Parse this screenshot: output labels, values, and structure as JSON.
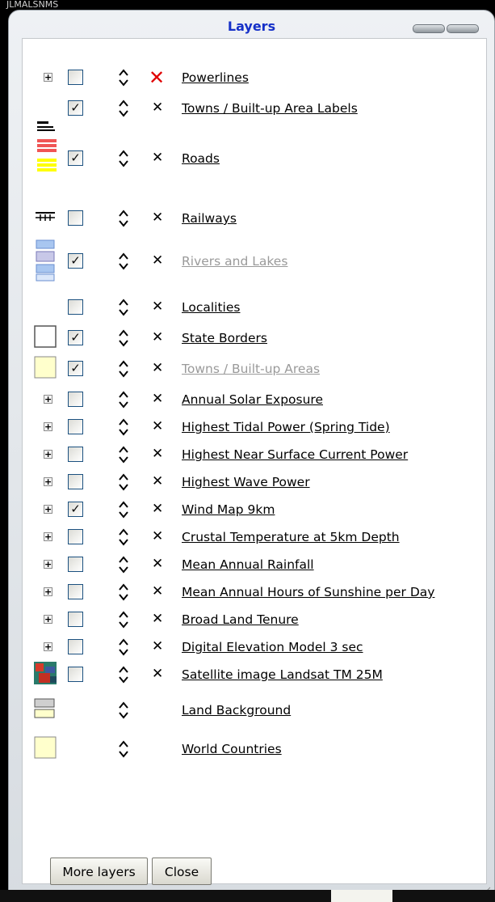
{
  "window": {
    "title": "Layers"
  },
  "top_strip_text": "JLMALSNMS",
  "layers": [
    {
      "id": "powerlines",
      "label": "Powerlines",
      "expand": true,
      "checkbox": true,
      "checked": false,
      "delete": "red-x",
      "label_color": "#000000"
    },
    {
      "id": "towns-labels",
      "label": "Towns / Built-up Area Labels",
      "expand": false,
      "checkbox": true,
      "checked": true,
      "delete": "x",
      "label_color": "#000000"
    },
    {
      "id": "roads",
      "label": "Roads",
      "expand": false,
      "checkbox": true,
      "checked": true,
      "delete": "x",
      "label_color": "#000000",
      "legend": "road-legend"
    },
    {
      "id": "railways",
      "label": "Railways",
      "expand": false,
      "checkbox": true,
      "checked": false,
      "delete": "x",
      "label_color": "#000000",
      "legend": "railway-legend"
    },
    {
      "id": "rivers",
      "label": "Rivers and Lakes",
      "expand": false,
      "checkbox": true,
      "checked": true,
      "delete": "x",
      "label_color": "#9a9a9a",
      "legend": "water-legend"
    },
    {
      "id": "localities",
      "label": "Localities",
      "expand": false,
      "checkbox": true,
      "checked": false,
      "delete": "x",
      "label_color": "#000000"
    },
    {
      "id": "state-borders",
      "label": "State Borders",
      "expand": false,
      "checkbox": true,
      "checked": true,
      "delete": "x",
      "label_color": "#000000",
      "legend": "white-box"
    },
    {
      "id": "towns-areas",
      "label": "Towns / Built-up Areas",
      "expand": false,
      "checkbox": true,
      "checked": true,
      "delete": "x",
      "label_color": "#9a9a9a",
      "legend": "yellow-box"
    },
    {
      "id": "solar",
      "label": "Annual Solar Exposure",
      "expand": true,
      "checkbox": true,
      "checked": false,
      "delete": "x",
      "label_color": "#000000"
    },
    {
      "id": "tidal",
      "label": "Highest Tidal Power (Spring Tide)",
      "expand": true,
      "checkbox": true,
      "checked": false,
      "delete": "x",
      "label_color": "#000000"
    },
    {
      "id": "current",
      "label": "Highest Near Surface Current Power",
      "expand": true,
      "checkbox": true,
      "checked": false,
      "delete": "x",
      "label_color": "#000000"
    },
    {
      "id": "wave",
      "label": "Highest Wave Power",
      "expand": true,
      "checkbox": true,
      "checked": false,
      "delete": "x",
      "label_color": "#000000"
    },
    {
      "id": "wind",
      "label": "Wind Map 9km",
      "expand": true,
      "checkbox": true,
      "checked": true,
      "delete": "x",
      "label_color": "#000000"
    },
    {
      "id": "crustal",
      "label": "Crustal Temperature at 5km Depth",
      "expand": true,
      "checkbox": true,
      "checked": false,
      "delete": "x",
      "label_color": "#000000"
    },
    {
      "id": "rainfall",
      "label": "Mean Annual Rainfall",
      "expand": true,
      "checkbox": true,
      "checked": false,
      "delete": "x",
      "label_color": "#000000"
    },
    {
      "id": "sunshine",
      "label": "Mean Annual Hours of Sunshine per Day",
      "expand": true,
      "checkbox": true,
      "checked": false,
      "delete": "x",
      "label_color": "#000000"
    },
    {
      "id": "tenure",
      "label": "Broad Land Tenure",
      "expand": true,
      "checkbox": true,
      "checked": false,
      "delete": "x",
      "label_color": "#000000"
    },
    {
      "id": "dem",
      "label": "Digital Elevation Model 3 sec",
      "expand": true,
      "checkbox": true,
      "checked": false,
      "delete": "x",
      "label_color": "#000000"
    },
    {
      "id": "landsat",
      "label": "Satellite image Landsat TM 25M",
      "expand": false,
      "checkbox": true,
      "checked": false,
      "delete": "x",
      "label_color": "#000000",
      "legend": "satellite-thumb"
    },
    {
      "id": "land-bg",
      "label": "Land Background",
      "expand": false,
      "checkbox": false,
      "checked": false,
      "delete": "none",
      "label_color": "#000000",
      "legend": "grey-yellow-legend"
    },
    {
      "id": "world",
      "label": "World Countries",
      "expand": false,
      "checkbox": false,
      "checked": false,
      "delete": "none",
      "label_color": "#000000",
      "legend": "yellow-box"
    }
  ],
  "buttons": {
    "more_layers": "More layers",
    "close": "Close"
  },
  "colors": {
    "title": "#1530c8",
    "accent_red": "#e00000",
    "road_red": "#f05555",
    "road_yellow": "#ffff00",
    "water_blue": "#a8c6f0",
    "pale_yellow": "#ffffcc"
  }
}
